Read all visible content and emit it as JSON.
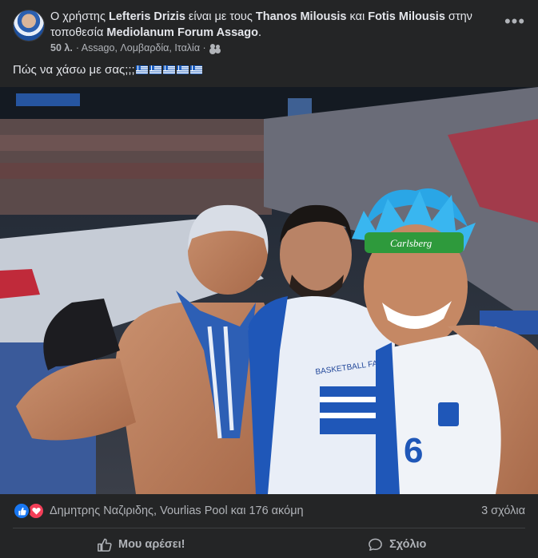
{
  "post": {
    "prefix": "Ο χρήστης ",
    "author": "Lefteris Drizis",
    "with_text": " είναι με τους ",
    "friend1": "Thanos Milousis",
    "and_text": " και ",
    "friend2": "Fotis Milousis",
    "location_text": " στην τοποθεσία ",
    "location": "Mediolanum Forum Assago",
    "location_end": ".",
    "time": "50 λ.",
    "place_meta": " · Assago, Λομβαρδία, Ιταλία · ",
    "audience_icon": "friends-icon",
    "more_label": "•••",
    "message": "Πώς να χάσω με σας;;;",
    "flag_count_label": "🇬🇷🇬🇷🇬🇷🇬🇷🇬🇷",
    "flag_icon": "greece-flag-icon"
  },
  "reactions": {
    "icons": [
      "like-icon",
      "love-icon"
    ],
    "summary": "Δημητρης Ναζιριδης, Vourlias Pool και 176 ακόμη",
    "comments": "3 σχόλια"
  },
  "actions": {
    "like_label": "Μου αρέσει!",
    "comment_label": "Σχόλιο"
  },
  "photo_text": {
    "hat_brand": "Carlsberg",
    "jersey_text": "BASKETBALL FAN",
    "jersey_number": "6"
  },
  "colors": {
    "background": "#242526",
    "text_primary": "#e4e6eb",
    "text_secondary": "#b0b3b8",
    "like_blue": "#1877f2",
    "love_red": "#f33e58"
  }
}
